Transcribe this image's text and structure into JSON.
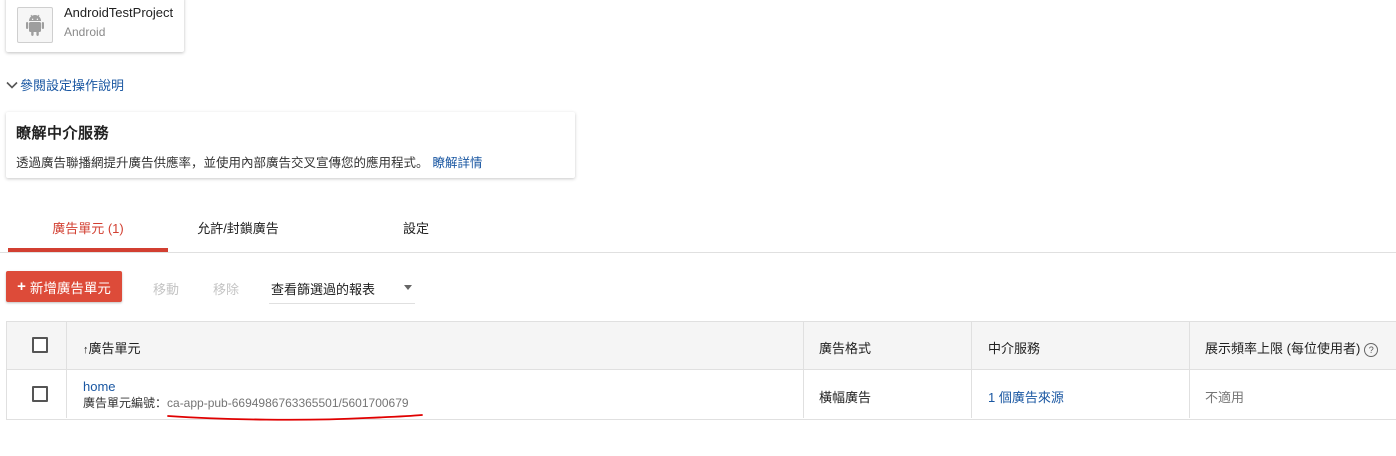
{
  "app": {
    "name": "AndroidTestProject",
    "platform": "Android",
    "icon": "android-icon"
  },
  "help_link": {
    "label": "參閱設定操作說明",
    "icon": "chevron-down-icon"
  },
  "mediation_card": {
    "title": "瞭解中介服務",
    "description": "透過廣告聯播網提升廣告供應率，並使用內部廣告交叉宣傳您的應用程式。",
    "link": "瞭解詳情"
  },
  "tabs": [
    {
      "label": "廣告單元 (1)",
      "active": true
    },
    {
      "label": "允許/封鎖廣告",
      "active": false
    },
    {
      "label": "設定",
      "active": false
    }
  ],
  "toolbar": {
    "new_button": "新增廣告單元",
    "move": "移動",
    "remove": "移除",
    "report_select": "查看篩選過的報表"
  },
  "table": {
    "headers": {
      "ad_unit": "廣告單元",
      "format": "廣告格式",
      "mediation": "中介服務",
      "frequency_cap": "展示頻率上限 (每位使用者)"
    },
    "rows": [
      {
        "name": "home",
        "id_label": "廣告單元編號：",
        "id": "ca-app-pub-6694986763365501/5601700679",
        "format": "橫幅廣告",
        "mediation": "1 個廣告來源",
        "frequency_cap": "不適用"
      }
    ]
  },
  "colors": {
    "accent": "#dd4b39",
    "tab_active": "#d23f31",
    "link": "#1a57a2",
    "annotation": "#e00000"
  }
}
